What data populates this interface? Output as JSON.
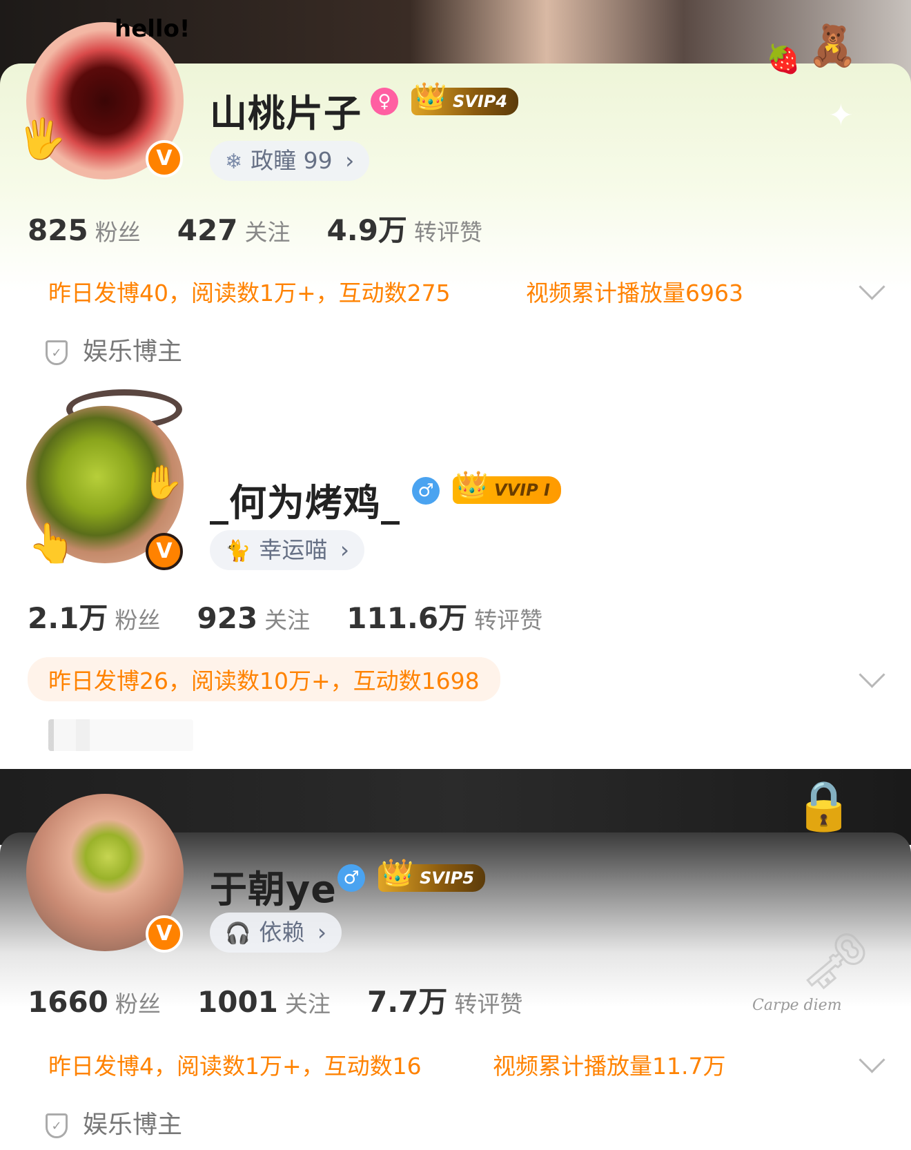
{
  "profiles": [
    {
      "avatar_overlay_text": "hello!",
      "name": "山桃片子",
      "gender_icon": "female-icon",
      "gender_glyph": "♀",
      "gender_color": "#ff5fa2",
      "vip_label": "SVIP4",
      "fan_group_icon": "snowflake-icon",
      "fan_group_glyph": "❄",
      "fan_group": "政瞳 99",
      "fan_group_arrow": "›",
      "stats": [
        {
          "num": "825",
          "label": "粉丝"
        },
        {
          "num": "427",
          "label": "关注"
        },
        {
          "num": "4.9万",
          "label": "转评赞"
        }
      ],
      "yesterday_info": "昨日发博40，阅读数1万+，互动数275",
      "video_info": "视频累计播放量6963",
      "category_icon_glyph": "✓",
      "category": "娱乐博主"
    },
    {
      "name": "_何为烤鸡_",
      "gender_icon": "male-icon",
      "gender_glyph": "♂",
      "gender_color": "#4aa3f0",
      "vip_label": "VVIP I",
      "fan_group_icon": "cat-icon",
      "fan_group_glyph": "🐈",
      "fan_group": "幸运喵",
      "fan_group_arrow": "›",
      "stats": [
        {
          "num": "2.1万",
          "label": "粉丝"
        },
        {
          "num": "923",
          "label": "关注"
        },
        {
          "num": "111.6万",
          "label": "转评赞"
        }
      ],
      "yesterday_info": "昨日发博26，阅读数10万+，互动数1698"
    },
    {
      "name": "于朝ye",
      "gender_icon": "male-icon",
      "gender_glyph": "♂",
      "gender_color": "#4aa3f0",
      "vip_label": "SVIP5",
      "fan_group_icon": "headphones-icon",
      "fan_group_glyph": "🎧",
      "fan_group": "依赖",
      "fan_group_arrow": "›",
      "banner_script_text": "Carpe diem",
      "stats": [
        {
          "num": "1660",
          "label": "粉丝"
        },
        {
          "num": "1001",
          "label": "关注"
        },
        {
          "num": "7.7万",
          "label": "转评赞"
        }
      ],
      "yesterday_info": "昨日发博4，阅读数1万+，互动数16",
      "video_info": "视频累计播放量11.7万",
      "category_icon_glyph": "✓",
      "category": "娱乐博主"
    }
  ],
  "verified_badge": "V",
  "colors": {
    "accent": "#ff8200",
    "info_text": "#ff8200"
  }
}
